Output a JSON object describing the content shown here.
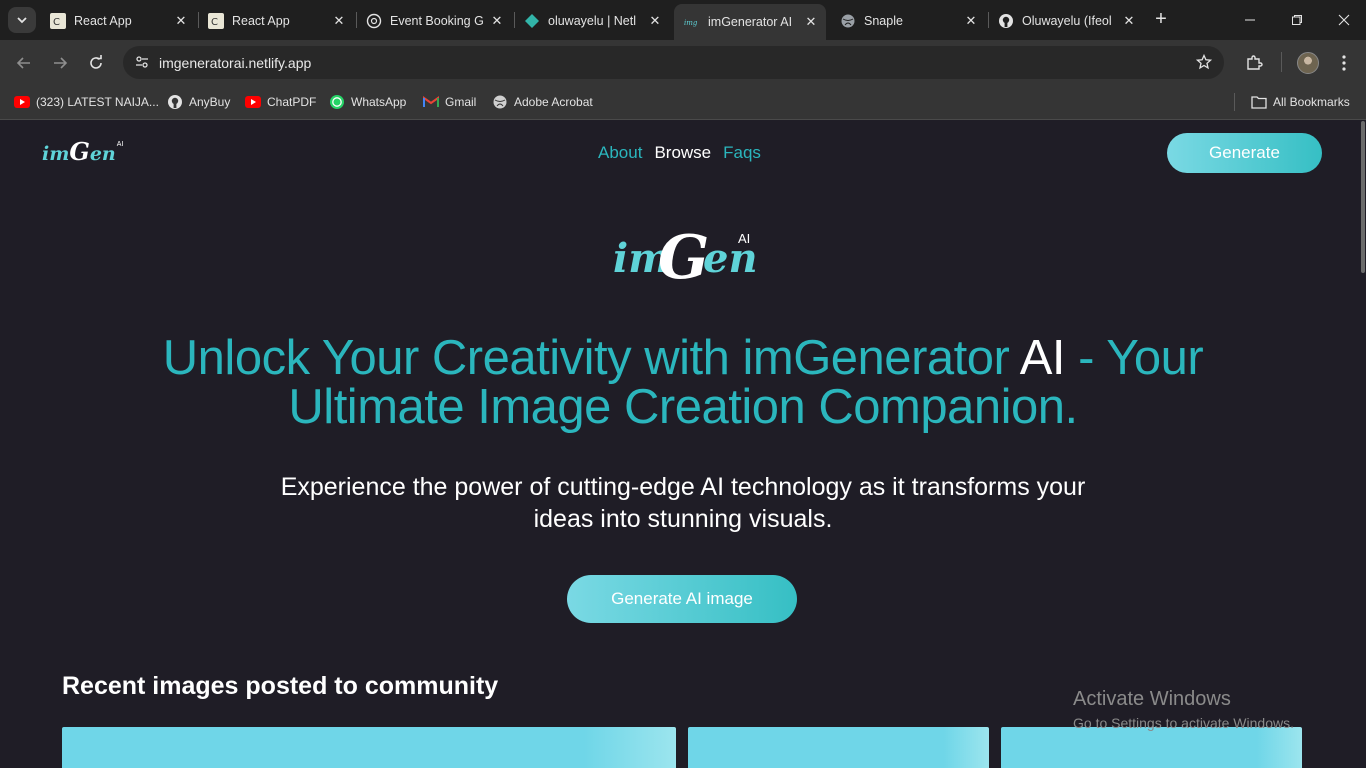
{
  "browser": {
    "tabs": [
      {
        "title": "React App",
        "icon": "react-app-icon",
        "active": false
      },
      {
        "title": "React App",
        "icon": "react-app-icon",
        "active": false
      },
      {
        "title": "Event Booking G",
        "icon": "chatgpt-icon",
        "active": false
      },
      {
        "title": "oluwayelu | Netl",
        "icon": "netlify-icon",
        "active": false
      },
      {
        "title": "imGenerator AI",
        "icon": "imgen-icon",
        "active": true
      },
      {
        "title": "Snaple",
        "icon": "globe-icon",
        "active": false
      },
      {
        "title": "Oluwayelu (Ifeol",
        "icon": "github-icon",
        "active": false
      }
    ],
    "url": "imgeneratorai.netlify.app",
    "bookmarks": [
      {
        "label": "(323) LATEST NAIJA...",
        "icon": "youtube-icon"
      },
      {
        "label": "AnyBuy",
        "icon": "github-icon"
      },
      {
        "label": "ChatPDF",
        "icon": "youtube-icon"
      },
      {
        "label": "WhatsApp",
        "icon": "whatsapp-icon"
      },
      {
        "label": "Gmail",
        "icon": "gmail-icon"
      },
      {
        "label": "Adobe Acrobat",
        "icon": "globe-icon"
      }
    ],
    "all_bookmarks": "All Bookmarks"
  },
  "site": {
    "logo": {
      "part1": "im",
      "part2": "G",
      "part3": "en",
      "ai": "AI"
    },
    "nav": {
      "about": "About",
      "browse": "Browse",
      "faqs": "Faqs"
    },
    "generate_button": "Generate",
    "hero": {
      "line1_a": "Unlock Your Creativity with imGenerator ",
      "line1_highlight": "AI",
      "line1_b": " - Your",
      "line2": "Ultimate Image Creation Companion."
    },
    "subtitle": "Experience the power of cutting-edge AI technology as it transforms your ideas into stunning visuals.",
    "cta_button": "Generate AI image",
    "section_title": "Recent images posted to community"
  },
  "overlay": {
    "activate_title": "Activate Windows",
    "activate_sub": "Go to Settings to activate Windows."
  },
  "colors": {
    "accent": "#2bb6bd",
    "button_gradient_start": "#7ad9e4",
    "button_gradient_end": "#36bfc4",
    "page_bg": "#1f1d26"
  }
}
